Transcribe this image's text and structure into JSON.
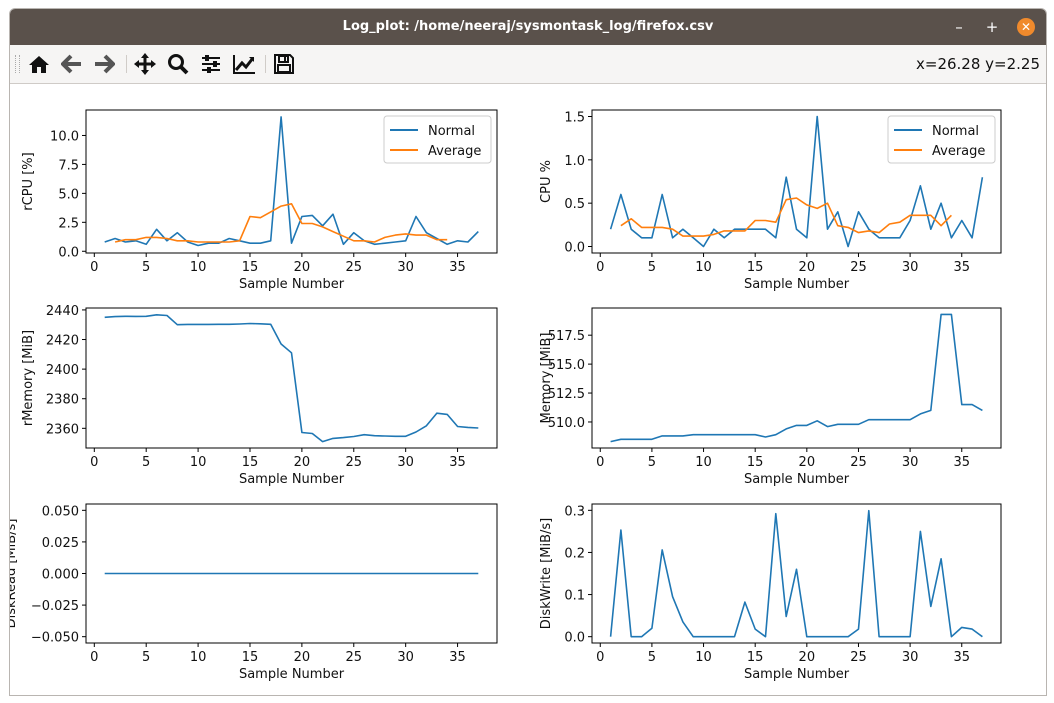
{
  "window": {
    "title": "Log_plot: /home/neeraj/sysmontask_log/firefox.csv",
    "minimize": "–",
    "maximize": "+",
    "close": "✕"
  },
  "toolbar": {
    "buttons": [
      {
        "name": "home-button",
        "icon": "home-icon"
      },
      {
        "name": "back-button",
        "icon": "arrow-left-icon"
      },
      {
        "name": "forward-button",
        "icon": "arrow-right-icon"
      },
      {
        "name": "pan-button",
        "icon": "move-icon"
      },
      {
        "name": "zoom-button",
        "icon": "magnifier-icon"
      },
      {
        "name": "subplots-button",
        "icon": "sliders-icon"
      },
      {
        "name": "edit-axes-button",
        "icon": "line-chart-icon"
      },
      {
        "name": "save-button",
        "icon": "floppy-disk-icon"
      }
    ],
    "coords": "x=26.28 y=2.25"
  },
  "colors": {
    "normal": "#1f77b4",
    "average": "#ff7f0e"
  },
  "chart_data": [
    {
      "type": "line",
      "ylabel": "rCPU [%]",
      "xlabel": "Sample Number",
      "xlim": [
        -0.8,
        38.8
      ],
      "ylim": [
        -0.15,
        12.2
      ],
      "xticks": [
        "0",
        "5",
        "10",
        "15",
        "20",
        "25",
        "30",
        "35"
      ],
      "yticks": [
        "0.0",
        "2.5",
        "5.0",
        "7.5",
        "10.0"
      ],
      "legend": "top-right",
      "series": [
        {
          "name": "Normal",
          "x_start": 1,
          "values": [
            0.8,
            1.1,
            0.8,
            0.9,
            0.6,
            1.9,
            0.9,
            1.6,
            0.8,
            0.5,
            0.7,
            0.7,
            1.1,
            0.9,
            0.7,
            0.7,
            0.9,
            11.6,
            0.7,
            3.0,
            3.1,
            2.2,
            3.2,
            0.6,
            1.6,
            0.9,
            0.6,
            0.7,
            0.8,
            0.9,
            3.0,
            1.6,
            1.1,
            0.6,
            0.9,
            0.8,
            1.7
          ]
        },
        {
          "name": "Average",
          "x_start": 2,
          "values": [
            0.8,
            1.0,
            1.0,
            1.2,
            1.2,
            1.1,
            0.9,
            0.9,
            0.8,
            0.8,
            0.8,
            0.8,
            0.9,
            3.0,
            2.9,
            3.4,
            3.9,
            4.1,
            2.4,
            2.4,
            2.1,
            1.7,
            1.3,
            0.9,
            0.9,
            0.8,
            1.2,
            1.4,
            1.5,
            1.4,
            1.4,
            1.0,
            1.0
          ]
        }
      ]
    },
    {
      "type": "line",
      "ylabel": "CPU %",
      "xlabel": "Sample Number",
      "xlim": [
        -0.8,
        38.8
      ],
      "ylim": [
        -0.075,
        1.575
      ],
      "xticks": [
        "0",
        "5",
        "10",
        "15",
        "20",
        "25",
        "30",
        "35"
      ],
      "yticks": [
        "0.0",
        "0.5",
        "1.0",
        "1.5"
      ],
      "legend": "top-right",
      "series": [
        {
          "name": "Normal",
          "x_start": 1,
          "values": [
            0.2,
            0.6,
            0.2,
            0.1,
            0.1,
            0.6,
            0.1,
            0.2,
            0.1,
            0.0,
            0.2,
            0.1,
            0.2,
            0.2,
            0.2,
            0.2,
            0.1,
            0.8,
            0.2,
            0.1,
            1.5,
            0.2,
            0.4,
            0.0,
            0.4,
            0.2,
            0.1,
            0.1,
            0.1,
            0.3,
            0.7,
            0.2,
            0.5,
            0.1,
            0.3,
            0.1,
            0.8
          ]
        },
        {
          "name": "Average",
          "x_start": 2,
          "values": [
            0.24,
            0.32,
            0.22,
            0.22,
            0.22,
            0.2,
            0.12,
            0.12,
            0.12,
            0.14,
            0.18,
            0.18,
            0.18,
            0.3,
            0.3,
            0.28,
            0.54,
            0.56,
            0.48,
            0.44,
            0.5,
            0.24,
            0.22,
            0.16,
            0.18,
            0.16,
            0.26,
            0.28,
            0.36,
            0.36,
            0.36,
            0.24,
            0.36
          ]
        }
      ]
    },
    {
      "type": "line",
      "ylabel": "rMemory [MiB]",
      "xlabel": "Sample Number",
      "xlim": [
        -0.8,
        38.8
      ],
      "ylim": [
        2346.7,
        2441.3
      ],
      "xticks": [
        "0",
        "5",
        "10",
        "15",
        "20",
        "25",
        "30",
        "35"
      ],
      "yticks": [
        "2360",
        "2380",
        "2400",
        "2420",
        "2440"
      ],
      "series": [
        {
          "x_start": 1,
          "values": [
            2435,
            2435.5,
            2435.7,
            2435.6,
            2435.7,
            2436.7,
            2436.2,
            2430,
            2430.2,
            2430.2,
            2430.2,
            2430.3,
            2430.3,
            2430.5,
            2430.8,
            2430.6,
            2430.3,
            2417,
            2411,
            2357.2,
            2356.5,
            2351,
            2353.2,
            2353.7,
            2354.5,
            2355.7,
            2355,
            2354.8,
            2354.6,
            2354.6,
            2357.5,
            2361.7,
            2370.2,
            2369.4,
            2361.2,
            2360.6,
            2360.2
          ]
        }
      ]
    },
    {
      "type": "line",
      "ylabel": "Memory [MiB]",
      "xlabel": "Sample Number",
      "xlim": [
        -0.8,
        38.8
      ],
      "ylim": [
        507.75,
        519.85
      ],
      "xticks": [
        "0",
        "5",
        "10",
        "15",
        "20",
        "25",
        "30",
        "35"
      ],
      "yticks": [
        "510.0",
        "512.5",
        "515.0",
        "517.5"
      ],
      "series": [
        {
          "x_start": 1,
          "values": [
            508.3,
            508.5,
            508.5,
            508.5,
            508.5,
            508.8,
            508.8,
            508.8,
            508.9,
            508.9,
            508.9,
            508.9,
            508.9,
            508.9,
            508.9,
            508.7,
            508.9,
            509.4,
            509.7,
            509.7,
            510.1,
            509.6,
            509.8,
            509.8,
            509.8,
            510.2,
            510.2,
            510.2,
            510.2,
            510.2,
            510.7,
            511.0,
            519.3,
            519.3,
            511.5,
            511.5,
            511.0
          ]
        }
      ]
    },
    {
      "type": "line",
      "ylabel": "DiskRead [MiB/s]",
      "xlabel": "Sample Number",
      "xlim": [
        -0.8,
        38.8
      ],
      "ylim": [
        -0.055,
        0.055
      ],
      "xticks": [
        "0",
        "5",
        "10",
        "15",
        "20",
        "25",
        "30",
        "35"
      ],
      "yticks": [
        "−0.050",
        "−0.025",
        "0.000",
        "0.025",
        "0.050"
      ],
      "series": [
        {
          "x_start": 1,
          "values": [
            0,
            0,
            0,
            0,
            0,
            0,
            0,
            0,
            0,
            0,
            0,
            0,
            0,
            0,
            0,
            0,
            0,
            0,
            0,
            0,
            0,
            0,
            0,
            0,
            0,
            0,
            0,
            0,
            0,
            0,
            0,
            0,
            0,
            0,
            0,
            0,
            0
          ]
        }
      ]
    },
    {
      "type": "line",
      "ylabel": "DiskWrite [MiB/s]",
      "xlabel": "Sample Number",
      "xlim": [
        -0.8,
        38.8
      ],
      "ylim": [
        -0.015,
        0.315
      ],
      "xticks": [
        "0",
        "5",
        "10",
        "15",
        "20",
        "25",
        "30",
        "35"
      ],
      "yticks": [
        "0.0",
        "0.1",
        "0.2",
        "0.3"
      ],
      "series": [
        {
          "x_start": 1,
          "values": [
            0,
            0.253,
            0,
            0,
            0.02,
            0.206,
            0.095,
            0.035,
            0,
            0,
            0,
            0,
            0,
            0.082,
            0.018,
            0,
            0.292,
            0.048,
            0.16,
            0,
            0,
            0,
            0,
            0,
            0.018,
            0.299,
            0,
            0,
            0,
            0,
            0.25,
            0.072,
            0.185,
            0,
            0.022,
            0.018,
            0
          ]
        }
      ]
    }
  ]
}
